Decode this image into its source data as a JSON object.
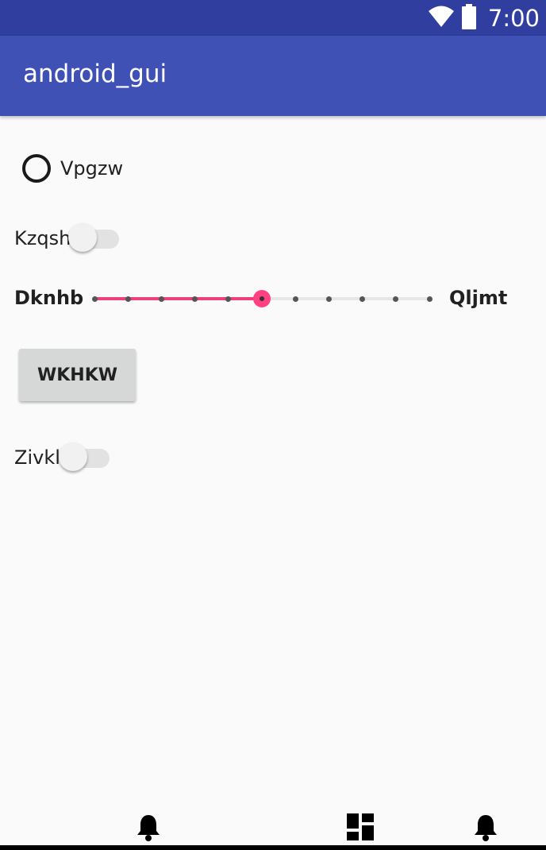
{
  "status_bar": {
    "time": "7:00",
    "icons": [
      "wifi-icon",
      "battery-icon"
    ],
    "color": "#303f9f"
  },
  "app_bar": {
    "title": "android_gui",
    "color": "#3f51b5"
  },
  "radio": {
    "label": "Vpgzw",
    "checked": false
  },
  "switch_1": {
    "label": "Kzqsh",
    "on": false
  },
  "slider": {
    "min_label": "Dknhb",
    "max_label": "Qljmt",
    "steps": 10,
    "value_step": 5,
    "accent": "#ff4081"
  },
  "button": {
    "label": "WKHKW"
  },
  "switch_2": {
    "label": "Zivkl",
    "on": false
  },
  "bottom_nav": {
    "icons": [
      "bell-icon",
      "dashboard-icon",
      "bell-icon"
    ]
  }
}
